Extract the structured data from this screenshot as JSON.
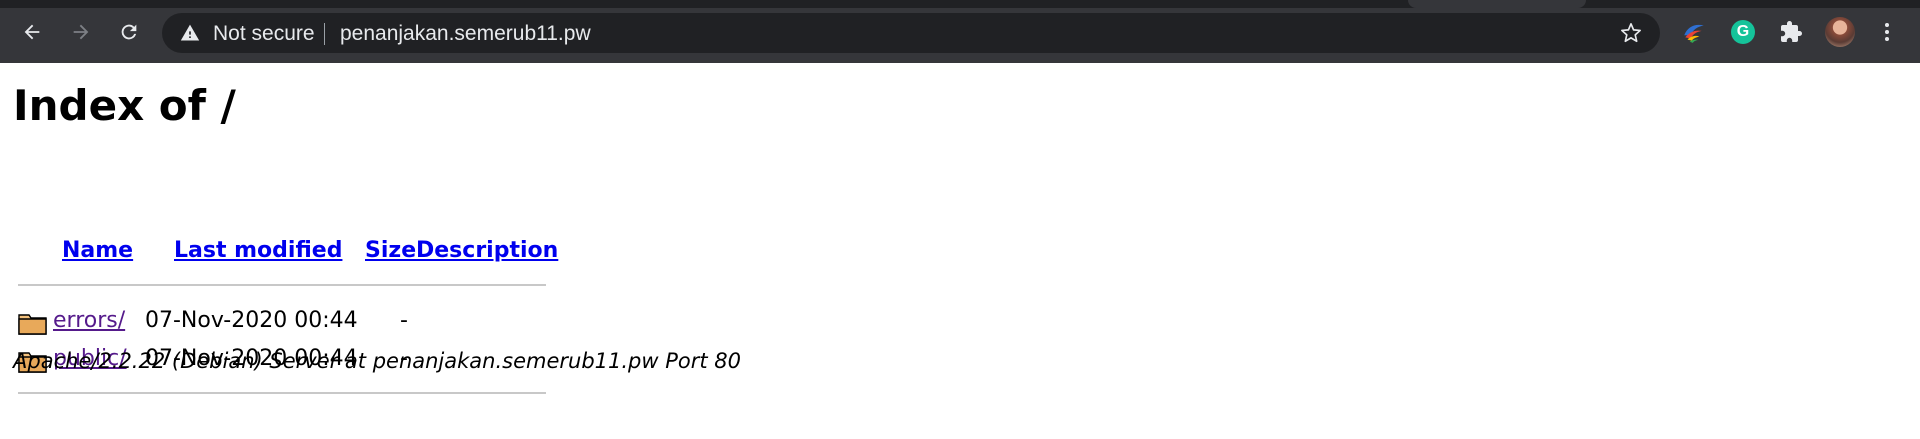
{
  "browser": {
    "security_label": "Not secure",
    "url": "penanjakan.semerub11.pw",
    "grammarly_letter": "G",
    "accent_colors": {
      "chrome": "#35363a",
      "omnibox": "#202124",
      "grammarly": "#15c39a"
    }
  },
  "icons": {
    "back": "arrow-left-icon",
    "forward": "arrow-right-icon",
    "reload": "reload-icon",
    "security": "warning-triangle-icon",
    "bookmark": "star-icon",
    "extension_1": "colorful-extension-icon",
    "extension_2": "grammarly-icon",
    "extensions_menu": "puzzle-icon",
    "profile": "avatar",
    "menu": "kebab-menu-icon",
    "folder": "folder-icon"
  },
  "page": {
    "title": "Index of /",
    "columns": {
      "name": "Name",
      "last_modified": "Last modified",
      "size": "Size",
      "description": "Description"
    },
    "rows": [
      {
        "name": "errors/",
        "last_modified": "07-Nov-2020 00:44",
        "size": "-"
      },
      {
        "name": "public/",
        "last_modified": "07-Nov-2020 00:44",
        "size": "-"
      }
    ],
    "footer": "Apache/2.2.22 (Debian) Server at penanjakan.semerub11.pw Port 80"
  }
}
